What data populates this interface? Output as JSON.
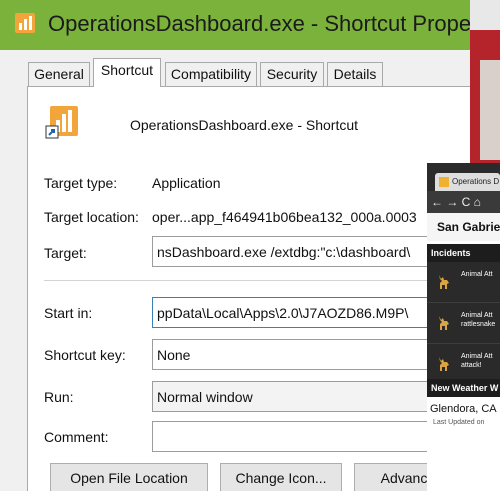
{
  "window": {
    "title": "OperationsDashboard.exe - Shortcut Propert..."
  },
  "tabs": [
    {
      "label": "General"
    },
    {
      "label": "Shortcut"
    },
    {
      "label": "Compatibility"
    },
    {
      "label": "Security"
    },
    {
      "label": "Details"
    }
  ],
  "shortcut": {
    "name": "OperationsDashboard.exe - Shortcut",
    "target_type_label": "Target type:",
    "target_type_value": "Application",
    "target_location_label": "Target location:",
    "target_location_value": "oper...app_f464941b06bea132_000a.0003",
    "target_label": "Target:",
    "target_value": "nsDashboard.exe /extdbg:\"c:\\dashboard\\",
    "start_in_label": "Start in:",
    "start_in_value": "ppData\\Local\\Apps\\2.0\\J7AOZD86.M9P\\",
    "shortcut_key_label": "Shortcut key:",
    "shortcut_key_value": "None",
    "run_label": "Run:",
    "run_value": "Normal window",
    "comment_label": "Comment:",
    "comment_value": ""
  },
  "buttons": {
    "open_file_location": "Open File Location",
    "change_icon": "Change Icon...",
    "advanced": "Advanc"
  },
  "overlay": {
    "tab_title": "Operations D",
    "nav": "← → C ⌂",
    "city": "San Gabriel",
    "incidents_header": "Incidents",
    "incidents": [
      {
        "line1": "Animal Att",
        "line2": ""
      },
      {
        "line1": "Animal Att",
        "line2": "rattlesnake"
      },
      {
        "line1": "Animal Att",
        "line2": "attack!"
      }
    ],
    "weather_header": "New Weather W",
    "weather_city": "Glendora, CA",
    "weather_updated": "Last Updated on"
  },
  "colors": {
    "titlebar": "#7bb23b",
    "backdrop": "#b5242b",
    "field_focus": "#3c7fb1"
  }
}
